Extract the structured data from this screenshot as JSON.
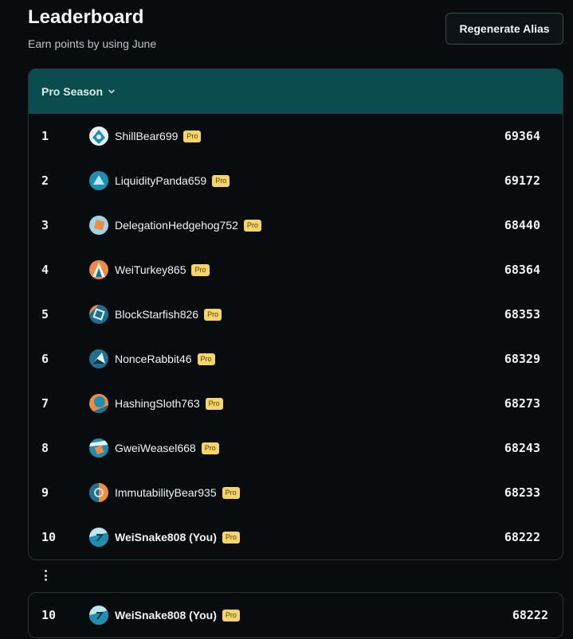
{
  "header": {
    "title": "Leaderboard",
    "subtitle": "Earn points by using June",
    "regenerate_label": "Regenerate Alias"
  },
  "board": {
    "season_label": "Pro Season",
    "badge_label": "Pro",
    "rows": [
      {
        "rank": "1",
        "name": "ShillBear699",
        "points": "69364"
      },
      {
        "rank": "2",
        "name": "LiquidityPanda659",
        "points": "69172"
      },
      {
        "rank": "3",
        "name": "DelegationHedgehog752",
        "points": "68440"
      },
      {
        "rank": "4",
        "name": "WeiTurkey865",
        "points": "68364"
      },
      {
        "rank": "5",
        "name": "BlockStarfish826",
        "points": "68353"
      },
      {
        "rank": "6",
        "name": "NonceRabbit46",
        "points": "68329"
      },
      {
        "rank": "7",
        "name": "HashingSloth763",
        "points": "68273"
      },
      {
        "rank": "8",
        "name": "GweiWeasel668",
        "points": "68243"
      },
      {
        "rank": "9",
        "name": "ImmutabilityBear935",
        "points": "68233"
      },
      {
        "rank": "10",
        "name": "WeiSnake808 (You)",
        "points": "68222"
      }
    ]
  },
  "current_user": {
    "rank": "10",
    "name": "WeiSnake808 (You)",
    "points": "68222"
  },
  "colors": {
    "header_bg": "#0b4d4f",
    "pro_badge": "#f5d46a",
    "avatar_teal": "#1f8fb0",
    "avatar_orange": "#f08a45"
  }
}
